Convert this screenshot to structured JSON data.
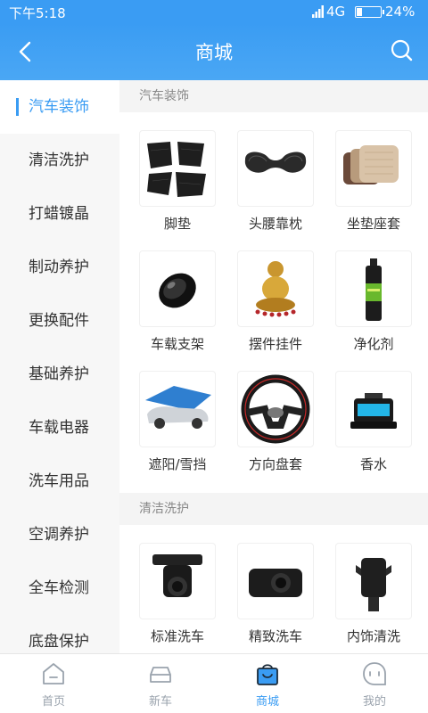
{
  "status_bar": {
    "time": "下午5:18",
    "network": "4G",
    "battery": "24%",
    "battery_level": 0.24
  },
  "header": {
    "title": "商城",
    "back_icon": "chevron-left-icon",
    "search_icon": "search-icon"
  },
  "sidebar": {
    "items": [
      {
        "label": "汽车装饰",
        "active": true
      },
      {
        "label": "清洁洗护"
      },
      {
        "label": "打蜡镀晶"
      },
      {
        "label": "制动养护"
      },
      {
        "label": "更换配件"
      },
      {
        "label": "基础养护"
      },
      {
        "label": "车载电器"
      },
      {
        "label": "洗车用品"
      },
      {
        "label": "空调养护"
      },
      {
        "label": "全车检测"
      },
      {
        "label": "底盘保护"
      }
    ]
  },
  "sections": [
    {
      "title": "汽车装饰",
      "products": [
        {
          "label": "脚垫",
          "icon": "floor-mat-image"
        },
        {
          "label": "头腰靠枕",
          "icon": "neck-pillow-image"
        },
        {
          "label": "坐垫座套",
          "icon": "seat-cushion-image"
        },
        {
          "label": "车载支架",
          "icon": "phone-holder-image"
        },
        {
          "label": "摆件挂件",
          "icon": "ornament-image"
        },
        {
          "label": "净化剂",
          "icon": "spray-can-image"
        },
        {
          "label": "遮阳/雪挡",
          "icon": "car-sunshade-image"
        },
        {
          "label": "方向盘套",
          "icon": "steering-wheel-image"
        },
        {
          "label": "香水",
          "icon": "car-perfume-image"
        }
      ]
    },
    {
      "title": "清洁洗护",
      "products": [
        {
          "label": "标准洗车",
          "icon": "dashcam-image"
        },
        {
          "label": "精致洗车",
          "icon": "camera-device-image"
        },
        {
          "label": "内饰清洗",
          "icon": "charger-holder-image"
        }
      ]
    }
  ],
  "tabbar": {
    "tabs": [
      {
        "label": "首页",
        "icon": "home-icon"
      },
      {
        "label": "新车",
        "icon": "car-icon"
      },
      {
        "label": "商城",
        "icon": "shopping-bag-icon",
        "active": true
      },
      {
        "label": "我的",
        "icon": "chat-bubble-icon"
      }
    ]
  },
  "colors": {
    "accent": "#3a9cf3",
    "sidebar_bg": "#f7f7f7",
    "section_bg": "#f4f4f4",
    "tab_inactive": "#9aa3ad"
  }
}
